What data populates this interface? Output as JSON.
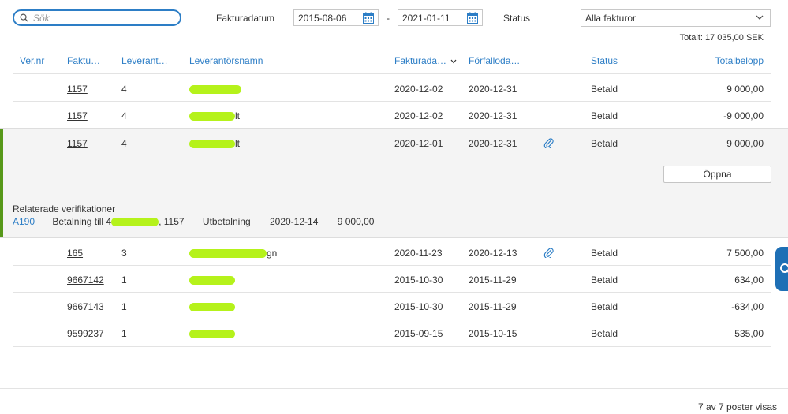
{
  "search": {
    "placeholder": "Sök"
  },
  "filters": {
    "date_label": "Fakturadatum",
    "date_from": "2015-08-06",
    "date_separator": "-",
    "date_to": "2021-01-11",
    "status_label": "Status",
    "status_value": "Alla fakturor"
  },
  "total": "Totalt: 17 035,00 SEK",
  "columns": {
    "vernr": "Ver.nr",
    "faktura": "Faktu…",
    "leverantor": "Leverant…",
    "leverantorsnamn": "Leverantörsnamn",
    "fakturadatum": "Fakturada…",
    "forfallodatum": "Förfalloda…",
    "status": "Status",
    "totalbelopp": "Totalbelopp"
  },
  "rows": [
    {
      "invoice": "1157",
      "supplier_no": "4",
      "name_suffix": "",
      "invoice_date": "2020-12-02",
      "due_date": "2020-12-31",
      "status": "Betald",
      "amount": "9 000,00",
      "attachment": false
    },
    {
      "invoice": "1157",
      "supplier_no": "4",
      "name_suffix": "lt",
      "invoice_date": "2020-12-02",
      "due_date": "2020-12-31",
      "status": "Betald",
      "amount": "-9 000,00",
      "attachment": false
    },
    {
      "invoice": "1157",
      "supplier_no": "4",
      "name_suffix": "lt",
      "invoice_date": "2020-12-01",
      "due_date": "2020-12-31",
      "status": "Betald",
      "amount": "9 000,00",
      "attachment": true
    },
    {
      "invoice": "165",
      "supplier_no": "3",
      "name_suffix": "gn",
      "invoice_date": "2020-11-23",
      "due_date": "2020-12-13",
      "status": "Betald",
      "amount": "7 500,00",
      "attachment": true
    },
    {
      "invoice": "9667142",
      "supplier_no": "1",
      "name_suffix": "",
      "invoice_date": "2015-10-30",
      "due_date": "2015-11-29",
      "status": "Betald",
      "amount": "634,00",
      "attachment": false
    },
    {
      "invoice": "9667143",
      "supplier_no": "1",
      "name_suffix": "",
      "invoice_date": "2015-10-30",
      "due_date": "2015-11-29",
      "status": "Betald",
      "amount": "-634,00",
      "attachment": false
    },
    {
      "invoice": "9599237",
      "supplier_no": "1",
      "name_suffix": "",
      "invoice_date": "2015-09-15",
      "due_date": "2015-10-15",
      "status": "Betald",
      "amount": "535,00",
      "attachment": false
    }
  ],
  "expanded": {
    "open_button": "Öppna",
    "related_title": "Relaterade verifikationer",
    "related": {
      "ver": "A190",
      "text_prefix": "Betalning till 4",
      "text_suffix": ", 1157",
      "type": "Utbetalning",
      "date": "2020-12-14",
      "amount": "9 000,00"
    }
  },
  "footer": "7 av 7 poster visas",
  "colors": {
    "accent": "#2d7ec6",
    "expanded_bar": "#57981a",
    "redaction": "#b5f21b"
  }
}
